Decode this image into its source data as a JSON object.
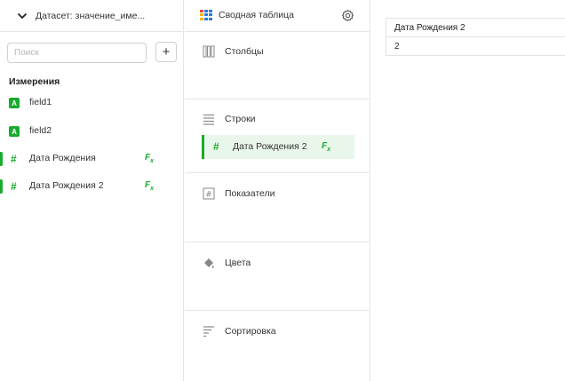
{
  "dataset": {
    "title": "Датасет:  значение_име..."
  },
  "search": {
    "placeholder": "Поиск",
    "value": "",
    "add_label": "+"
  },
  "dimensions": {
    "title": "Измерения",
    "fields": [
      {
        "type": "string",
        "badge": "A",
        "label": "field1",
        "formula": false
      },
      {
        "type": "number",
        "badge": "#",
        "label": "field2",
        "formula": false
      },
      {
        "type": "number",
        "badge": "#",
        "label": "Дата Рождения",
        "formula": true,
        "fx": "F",
        "fx_sub": "x"
      },
      {
        "type": "number",
        "badge": "#",
        "label": "Дата Рождения 2",
        "formula": true,
        "fx": "F",
        "fx_sub": "x"
      }
    ]
  },
  "visualization": {
    "title": "Сводная таблица",
    "icon": "pivot-table-icon",
    "settings_icon": "gear-icon"
  },
  "sections": [
    {
      "key": "columns",
      "label": "Столбцы",
      "icon": "columns-icon"
    },
    {
      "key": "rows",
      "label": "Строки",
      "icon": "rows-icon",
      "items": [
        {
          "badge": "#",
          "label": "Дата Рождения 2",
          "fx": "F",
          "fx_sub": "x"
        }
      ]
    },
    {
      "key": "measures",
      "label": "Показатели",
      "icon": "measures-icon"
    },
    {
      "key": "colors",
      "label": "Цвета",
      "icon": "paint-bucket-icon"
    },
    {
      "key": "sort",
      "label": "Сортировка",
      "icon": "sort-icon"
    }
  ],
  "preview": {
    "columns": [
      "Дата Рождения 2"
    ],
    "rows": [
      [
        "2"
      ]
    ]
  },
  "colors": {
    "accent": "#1aab2e",
    "pivot_icon": [
      "#e84c3d",
      "#2f7bd9",
      "#f5b400"
    ]
  }
}
